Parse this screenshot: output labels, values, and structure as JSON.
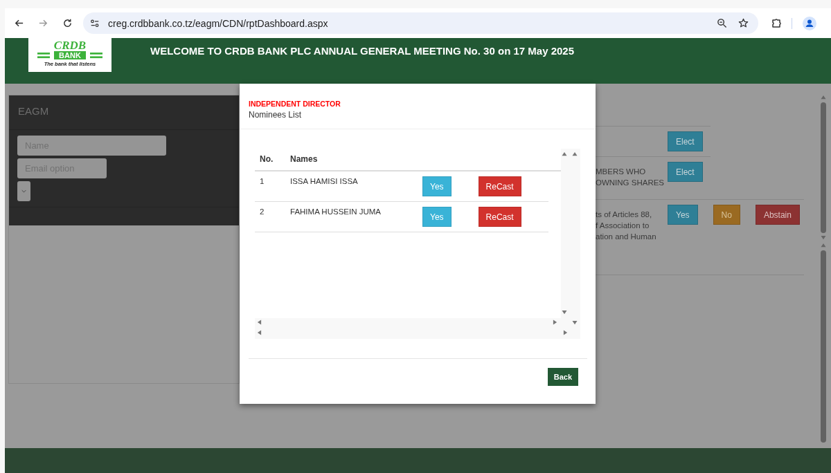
{
  "browser": {
    "url": "creg.crdbbank.co.tz/eagm/CDN/rptDashboard.aspx"
  },
  "header": {
    "logo": {
      "wordmark": "CRDB",
      "badge": "BANK",
      "tagline": "The bank that listens"
    },
    "title": "WELCOME TO CRDB BANK PLC ANNUAL GENERAL MEETING No. 30 on 17 May 2025"
  },
  "side_panel": {
    "title": "EAGM",
    "fields": [
      {
        "placeholder": "Name"
      },
      {
        "placeholder": "Email option"
      }
    ]
  },
  "agenda": {
    "rows": [
      {
        "buttons": [
          {
            "label": "Elect",
            "kind": "info"
          }
        ]
      },
      {
        "text_lines": [
          "MBERS WHO",
          "OWNING SHARES"
        ],
        "buttons": [
          {
            "label": "Elect",
            "kind": "info"
          }
        ]
      },
      {
        "text_lines": [
          "ts of Articles 88,",
          "f Association to",
          "ation and Human"
        ],
        "buttons": [
          {
            "label": "Yes",
            "kind": "info"
          },
          {
            "label": "No",
            "kind": "warning"
          },
          {
            "label": "Abstain",
            "kind": "danger"
          }
        ]
      }
    ]
  },
  "modal": {
    "kicker": "INDEPENDENT DIRECTOR",
    "title": "Nominees List",
    "columns": [
      "No.",
      "Names"
    ],
    "rows": [
      {
        "no": "1",
        "name": "ISSA HAMISI ISSA",
        "buttons": [
          {
            "label": "Yes",
            "kind": "info"
          },
          {
            "label": "ReCast",
            "kind": "danger"
          }
        ]
      },
      {
        "no": "2",
        "name": "FAHIMA HUSSEIN JUMA",
        "buttons": [
          {
            "label": "Yes",
            "kind": "info"
          },
          {
            "label": "ReCast",
            "kind": "danger"
          }
        ]
      }
    ],
    "back": "Back"
  }
}
